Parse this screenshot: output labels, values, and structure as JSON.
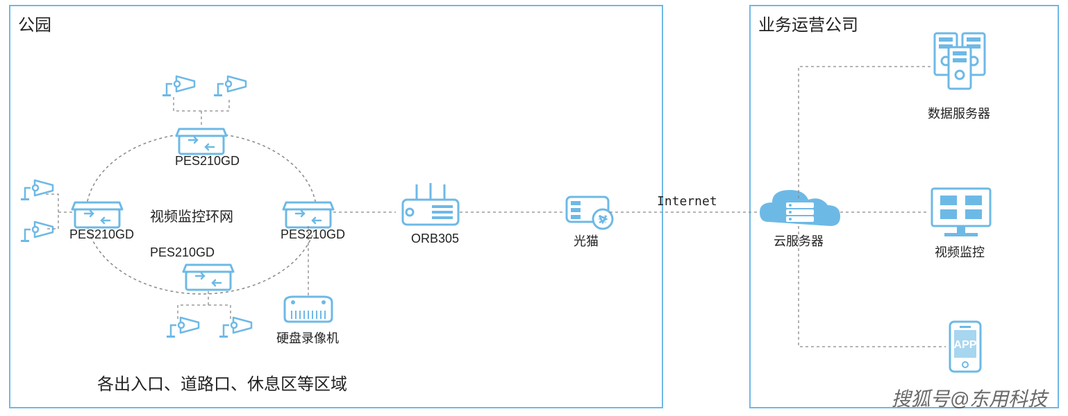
{
  "park": {
    "title": "公园",
    "ring_label": "视频监控环网",
    "footer": "各出入口、道路口、休息区等区域",
    "switch_label_top": "PES210GD",
    "switch_label_left": "PES210GD",
    "switch_label_bottom": "PES210GD",
    "switch_label_right": "PES210GD",
    "nvr_label": "硬盘录像机",
    "router_label": "ORB305",
    "modem_label": "光猫"
  },
  "center": {
    "internet_label": "Internet",
    "cloud_label": "云服务器"
  },
  "company": {
    "title": "业务运营公司",
    "servers_label": "数据服务器",
    "monitor_label": "视频监控",
    "app_label": "APP"
  },
  "watermark": "搜狐号@东用科技",
  "colors": {
    "border": "#6db9e6",
    "icon": "#6db9e6",
    "text": "#222222",
    "dash": "#888888"
  }
}
